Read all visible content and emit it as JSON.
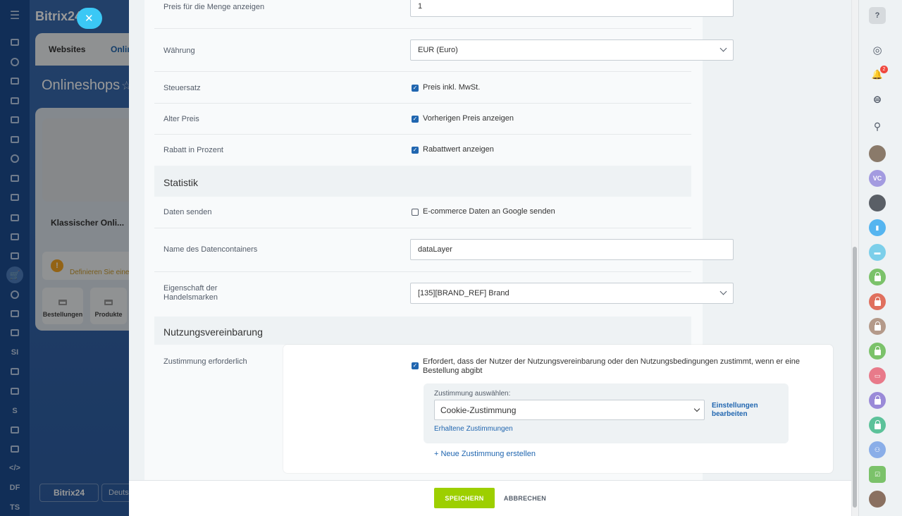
{
  "left_nav": {
    "items": [
      "home-icon",
      "flow-icon",
      "feed-icon",
      "chat-icon",
      "calendar-icon",
      "tasks-icon",
      "groups-icon",
      "docs-icon",
      "drive-icon",
      "funnel-icon",
      "analytics-icon",
      "robot-icon",
      "shop-icon",
      "target-icon",
      "sign-icon",
      "contact-center-icon",
      "SI",
      "forms-icon",
      "marketing-icon",
      "S",
      "automation-icon",
      "bank-icon",
      "dev-icon",
      "DF",
      "TS"
    ]
  },
  "background_app": {
    "brand": "Bitrix24",
    "tabs": [
      "Websites",
      "Onlin"
    ],
    "title": "Onlineshops",
    "shop_name": "Klassischer Onli...",
    "warning_text": "Definieren Sie eine",
    "tiles": [
      "Bestellungen",
      "Produkte"
    ],
    "footer_logo": "Bitrix24",
    "footer_lang": "Deuts"
  },
  "form": {
    "rows": {
      "price_quantity": {
        "label": "Preis für die Menge anzeigen",
        "value": "1"
      },
      "currency": {
        "label": "Währung",
        "value": "EUR (Euro)"
      },
      "tax": {
        "label": "Steuersatz",
        "checkbox_label": "Preis inkl. MwSt.",
        "checked": true
      },
      "old_price": {
        "label": "Alter Preis",
        "checkbox_label": "Vorherigen Preis anzeigen",
        "checked": true
      },
      "discount": {
        "label": "Rabatt in Prozent",
        "checkbox_label": "Rabattwert anzeigen",
        "checked": true
      }
    },
    "statistics": {
      "title": "Statistik",
      "send_data": {
        "label": "Daten senden",
        "checkbox_label": "E-commerce Daten an Google senden",
        "checked": false
      },
      "container_name": {
        "label": "Name des Datencontainers",
        "value": "dataLayer"
      },
      "brand_property": {
        "label": "Eigenschaft der Handelsmarken",
        "value": "[135][BRAND_REF] Brand"
      }
    },
    "agreement": {
      "title": "Nutzungsvereinbarung",
      "consent_required": {
        "label": "Zustimmung erforderlich",
        "checkbox_label": "Erfordert, dass der Nutzer der Nutzungsvereinbarung oder den Nutzungsbedingungen zustimmt, wenn er eine Bestellung abgibt",
        "checked": true
      },
      "select_label": "Zustimmung auswählen:",
      "selected_consent": "Cookie-Zustimmung",
      "edit_settings": "Einstellungen bearbeiten",
      "received_consents": "Erhaltene Zustimmungen",
      "new_consent": "+ Neue Zustimmung erstellen"
    }
  },
  "footer": {
    "save": "SPEICHERN",
    "cancel": "ABBRECHEN"
  },
  "right_bar": {
    "help": "?",
    "notification_count": "2",
    "avatar_initials": "VC"
  },
  "colors": {
    "accent": "#2066b0",
    "save_button": "#9dcf00",
    "slider_close": "#3bc8f5",
    "nav_background": "#1d4e91"
  }
}
